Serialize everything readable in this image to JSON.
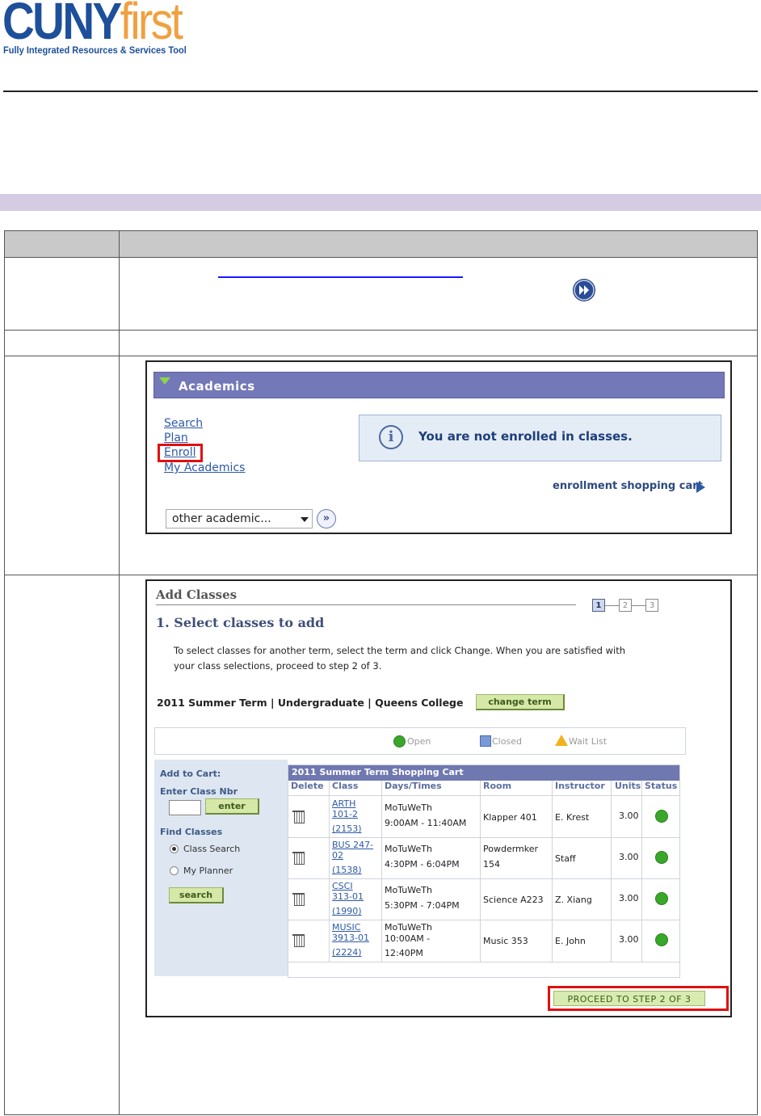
{
  "logo": {
    "brand_a": "CUNY",
    "brand_b": "first",
    "tagline": "Fully Integrated Resources & Services Tool"
  },
  "academics": {
    "title": "Academics",
    "links": [
      "Search",
      "Plan",
      "Enroll",
      "My Academics"
    ],
    "notice": "You are not enrolled in classes.",
    "cart_link": "enrollment shopping cart",
    "select_value": "other academic..."
  },
  "add_classes": {
    "title": "Add Classes",
    "steps": [
      "1",
      "2",
      "3"
    ],
    "subtitle": "1.  Select classes to add",
    "description": "To select classes for another term, select the term and click Change.  When you are satisfied with your class selections, proceed to step 2 of 3.",
    "term_line": "2011 Summer Term | Undergraduate | Queens College",
    "change_term": "change term",
    "legend": {
      "open": "Open",
      "closed": "Closed",
      "wait": "Wait List"
    },
    "side": {
      "add_to_cart": "Add to Cart:",
      "enter_class_nbr": "Enter Class Nbr",
      "enter_btn": "enter",
      "find_classes": "Find Classes",
      "opt_class_search": "Class Search",
      "opt_my_planner": "My Planner",
      "search_btn": "search"
    },
    "cart_title": "2011 Summer Term Shopping Cart",
    "columns": [
      "Delete",
      "Class",
      "Days/Times",
      "Room",
      "Instructor",
      "Units",
      "Status"
    ],
    "rows": [
      {
        "class_a": "ARTH",
        "class_b": "101-2",
        "class_c": "(2153)",
        "days": "MoTuWeTh",
        "times": "9:00AM - 11:40AM",
        "room_a": "Klapper 401",
        "room_b": "",
        "instructor": "E. Krest",
        "units": "3.00"
      },
      {
        "class_a": "BUS 247-",
        "class_b": "02",
        "class_c": "(1538)",
        "days": "MoTuWeTh",
        "times": "4:30PM - 6:04PM",
        "room_a": "Powdermker",
        "room_b": "154",
        "instructor": "Staff",
        "units": "3.00"
      },
      {
        "class_a": "CSCI",
        "class_b": "313-01",
        "class_c": "(1990)",
        "days": "MoTuWeTh",
        "times": "5:30PM - 7:04PM",
        "room_a": "Science A223",
        "room_b": "",
        "instructor": "Z. Xiang",
        "units": "3.00"
      },
      {
        "class_a": "MUSIC",
        "class_b": "3913-01",
        "class_c": "(2224)",
        "days": "MoTuWeTh",
        "times": "10:00AM -",
        "times2": "12:40PM",
        "room_a": "Music 353",
        "room_b": "",
        "instructor": "E. John",
        "units": "3.00"
      }
    ],
    "proceed": "PROCEED TO STEP 2 OF 3"
  },
  "colors": {
    "brand_blue": "#1d4f9a",
    "brand_orange": "#f0a040",
    "highlight_red": "#e01010",
    "header_purple": "#7378b8"
  }
}
